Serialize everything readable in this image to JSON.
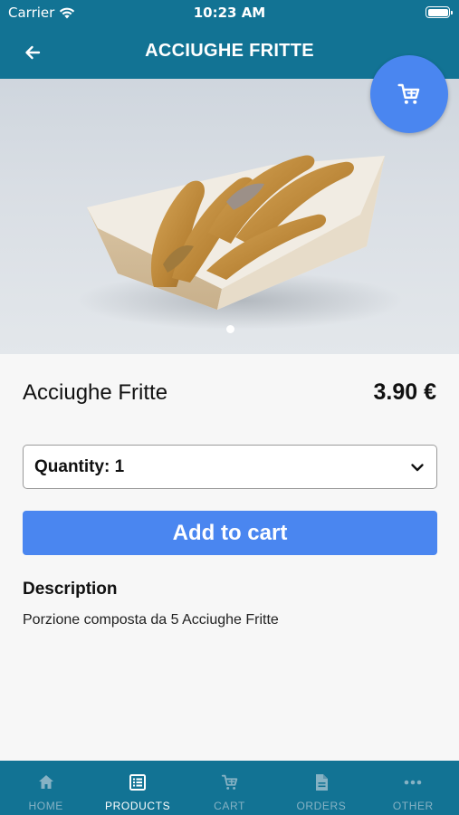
{
  "status_bar": {
    "carrier": "Carrier",
    "time": "10:23 AM"
  },
  "header": {
    "title": "ACCIUGHE FRITTE",
    "back_icon": "arrow-left-icon"
  },
  "cart_button": {
    "icon": "cart-icon"
  },
  "product": {
    "name": "Acciughe Fritte",
    "price": "3.90 €",
    "quantity_label": "Quantity: 1",
    "add_to_cart_label": "Add to cart",
    "description_title": "Description",
    "description_text": "Porzione composta da 5 Acciughe Fritte"
  },
  "gallery": {
    "image_count": 1,
    "active_index": 1
  },
  "colors": {
    "brand": "#127394",
    "accent": "#4a86f0",
    "inactive_tab": "#86b2c4"
  },
  "tabbar": {
    "tabs": [
      {
        "label": "HOME",
        "icon": "home-icon",
        "active": false
      },
      {
        "label": "PRODUCTS",
        "icon": "list-icon",
        "active": true
      },
      {
        "label": "CART",
        "icon": "cart-icon",
        "active": false
      },
      {
        "label": "ORDERS",
        "icon": "document-icon",
        "active": false
      },
      {
        "label": "OTHER",
        "icon": "more-icon",
        "active": false
      }
    ]
  }
}
